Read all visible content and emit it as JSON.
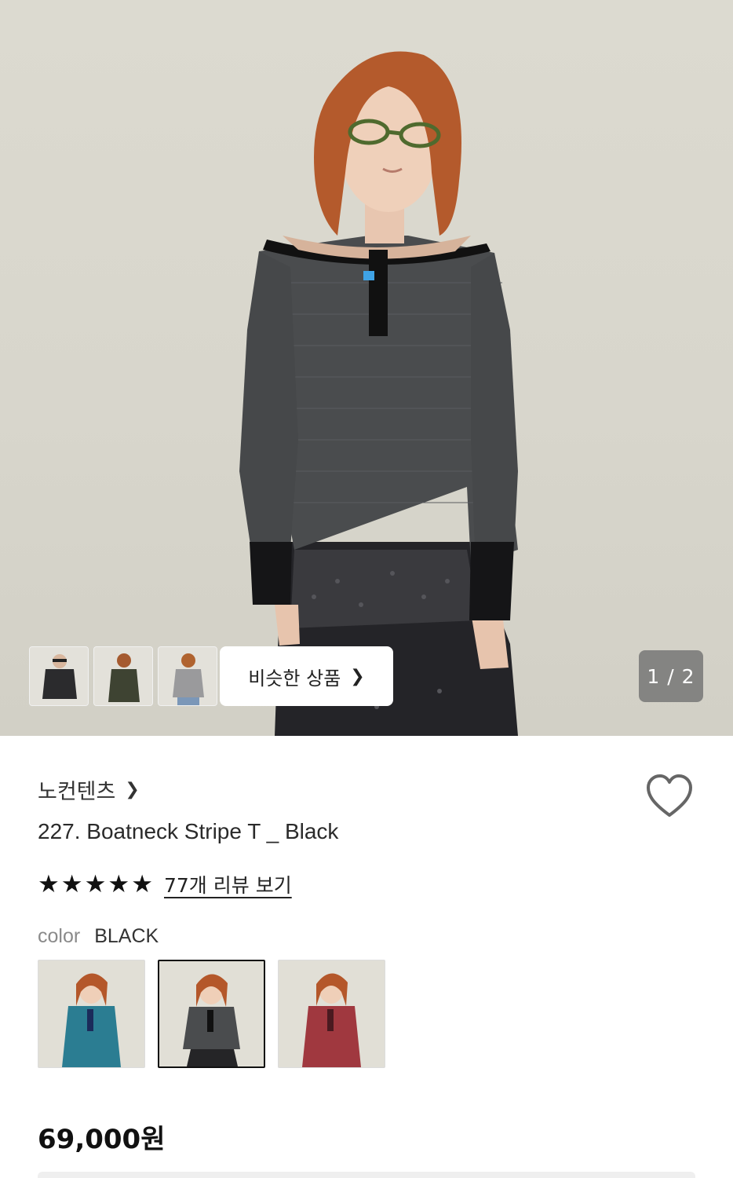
{
  "gallery": {
    "similar_label": "비슷한 상품",
    "counter": "1 / 2",
    "thumbnails": [
      "black top",
      "olive top",
      "grey top"
    ]
  },
  "product": {
    "brand": "노컨텐츠",
    "title": "227. Boatneck Stripe T _ Black",
    "rating_stars": 5,
    "review_link": "77개 리뷰 보기",
    "color_label": "color",
    "color_value": "BLACK",
    "swatches": [
      "teal",
      "black",
      "red"
    ],
    "price": "69,000원"
  },
  "colors": {
    "accent": "#111111",
    "hero_bg": "#dcdad0",
    "counter_bg": "#6e6e6e"
  }
}
